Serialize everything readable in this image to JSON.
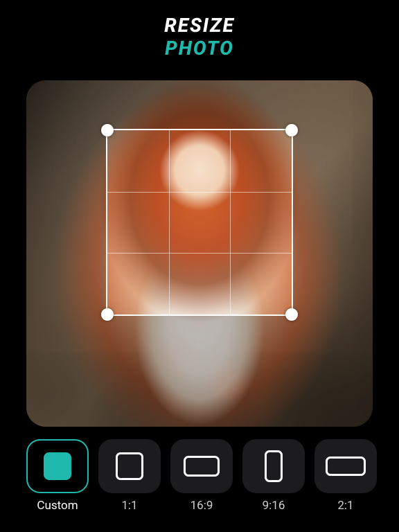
{
  "header": {
    "line1": "RESIZE",
    "line2": "PHOTO"
  },
  "colors": {
    "accent": "#1fb8ac"
  },
  "crop": {
    "grid": "rule-of-thirds",
    "handles": 4
  },
  "ratios": [
    {
      "id": "custom",
      "label": "Custom",
      "selected": true
    },
    {
      "id": "1_1",
      "label": "1:1",
      "selected": false
    },
    {
      "id": "16_9",
      "label": "16:9",
      "selected": false
    },
    {
      "id": "9_16",
      "label": "9:16",
      "selected": false
    },
    {
      "id": "2_1",
      "label": "2:1",
      "selected": false
    }
  ]
}
